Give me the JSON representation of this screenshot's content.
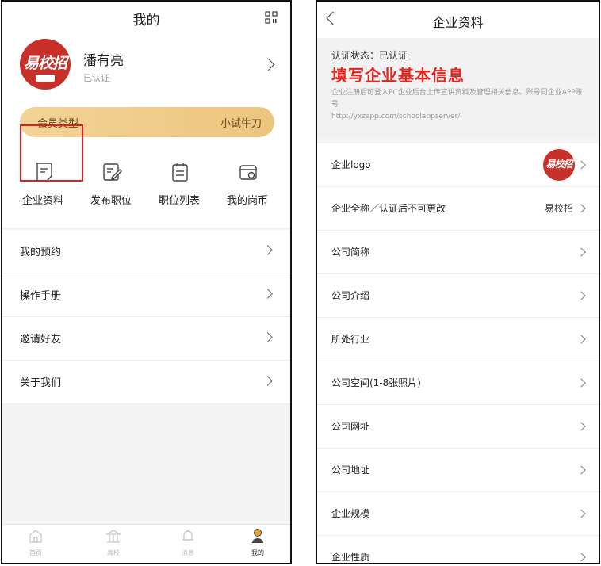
{
  "left": {
    "header": {
      "title": "我的"
    },
    "profile": {
      "logo_text": "易校招",
      "name": "潘有亮",
      "status": "已认证"
    },
    "member": {
      "label": "会员类型",
      "value": "小试牛刀"
    },
    "grid": [
      {
        "label": "企业资料",
        "icon": "document-icon"
      },
      {
        "label": "发布职位",
        "icon": "edit-icon"
      },
      {
        "label": "职位列表",
        "icon": "list-icon"
      },
      {
        "label": "我的岗币",
        "icon": "wallet-icon"
      }
    ],
    "menu": [
      {
        "label": "我的预约"
      },
      {
        "label": "操作手册"
      },
      {
        "label": "邀请好友"
      },
      {
        "label": "关于我们"
      }
    ],
    "tabbar": [
      {
        "label": "首页",
        "icon": "home-icon"
      },
      {
        "label": "高校",
        "icon": "school-icon"
      },
      {
        "label": "消息",
        "icon": "bell-icon"
      },
      {
        "label": "我的",
        "icon": "user-icon"
      }
    ],
    "accent_color": "#e02020",
    "member_color": "#eec98a"
  },
  "right": {
    "header": {
      "title": "企业资料"
    },
    "cert": {
      "status": "认证状态：已认证",
      "headline": "填写企业基本信息",
      "desc": "企业注册后可登入PC企业后台上传宣讲资料及管理相关信息。账号同企业APP账号",
      "url": "http://yxzapp.com/schoolappserver/"
    },
    "rows": [
      {
        "label": "企业logo",
        "value": ""
      },
      {
        "label": "企业全称／认证后不可更改",
        "value": "易校招"
      },
      {
        "label": "公司简称",
        "value": ""
      },
      {
        "label": "公司介绍",
        "value": ""
      },
      {
        "label": "所处行业",
        "value": ""
      },
      {
        "label": "公司空间(1-8张照片)",
        "value": ""
      },
      {
        "label": "公司网址",
        "value": ""
      },
      {
        "label": "公司地址",
        "value": ""
      },
      {
        "label": "企业规模",
        "value": ""
      },
      {
        "label": "企业性质",
        "value": ""
      }
    ],
    "logo_text": "易校招",
    "headline_color": "#e8221d"
  }
}
